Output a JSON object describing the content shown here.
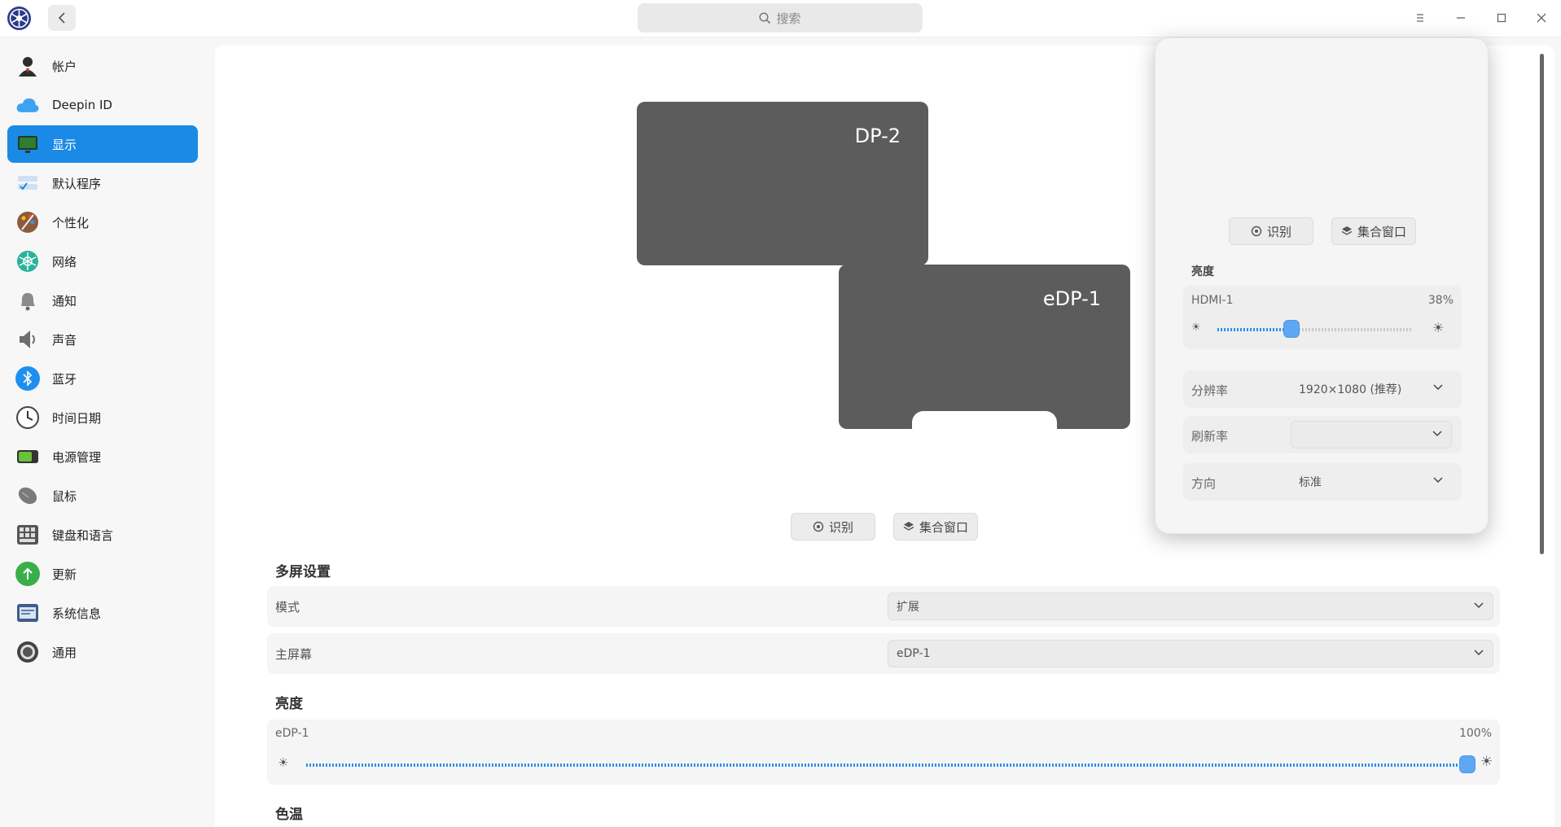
{
  "titlebar": {
    "search_placeholder": "搜索",
    "back_label": "<"
  },
  "sidebar": {
    "items": [
      {
        "label": "帐户",
        "icon": "user-icon",
        "color": "#3a3a3a"
      },
      {
        "label": "Deepin ID",
        "icon": "cloud-icon",
        "color": "#3ca3f0"
      },
      {
        "label": "显示",
        "icon": "display-icon",
        "color": "#2e7d32",
        "active": true
      },
      {
        "label": "默认程序",
        "icon": "default-apps-icon",
        "color": "#6aa8f0"
      },
      {
        "label": "个性化",
        "icon": "personalization-icon",
        "color": "#b5553a"
      },
      {
        "label": "网络",
        "icon": "network-icon",
        "color": "#2bb39a"
      },
      {
        "label": "通知",
        "icon": "bell-icon",
        "color": "#808080"
      },
      {
        "label": "声音",
        "icon": "speaker-icon",
        "color": "#666666"
      },
      {
        "label": "蓝牙",
        "icon": "bluetooth-icon",
        "color": "#1e8ff0"
      },
      {
        "label": "时间日期",
        "icon": "clock-icon",
        "color": "#555555"
      },
      {
        "label": "电源管理",
        "icon": "battery-icon",
        "color": "#4caf50"
      },
      {
        "label": "鼠标",
        "icon": "mouse-icon",
        "color": "#777777"
      },
      {
        "label": "键盘和语言",
        "icon": "keyboard-icon",
        "color": "#555555"
      },
      {
        "label": "更新",
        "icon": "update-icon",
        "color": "#3aae49"
      },
      {
        "label": "系统信息",
        "icon": "system-info-icon",
        "color": "#4a6fa5"
      },
      {
        "label": "通用",
        "icon": "general-icon",
        "color": "#444444"
      }
    ]
  },
  "main": {
    "screens": [
      {
        "name": "DP-2"
      },
      {
        "name": "eDP-1"
      }
    ],
    "identify_label": "识别",
    "gather_windows_label": "集合窗口",
    "multi_screen": {
      "title": "多屏设置",
      "mode_label": "模式",
      "mode_value": "扩展",
      "primary_label": "主屏幕",
      "primary_value": "eDP-1"
    },
    "brightness": {
      "title": "亮度",
      "display": "eDP-1",
      "percent_text": "100%",
      "value": 1.0
    },
    "color_temp_title": "色温"
  },
  "popup": {
    "identify_label": "识别",
    "gather_windows_label": "集合窗口",
    "brightness_title": "亮度",
    "brightness_display": "HDMI-1",
    "brightness_percent_text": "38%",
    "brightness_value": 0.38,
    "resolution_label": "分辨率",
    "resolution_value": "1920×1080 (推荐)",
    "refresh_label": "刷新率",
    "refresh_value": "",
    "orientation_label": "方向",
    "orientation_value": "标准"
  },
  "colors": {
    "accent": "#1b8ae6",
    "screen": "#5c5c5c"
  }
}
